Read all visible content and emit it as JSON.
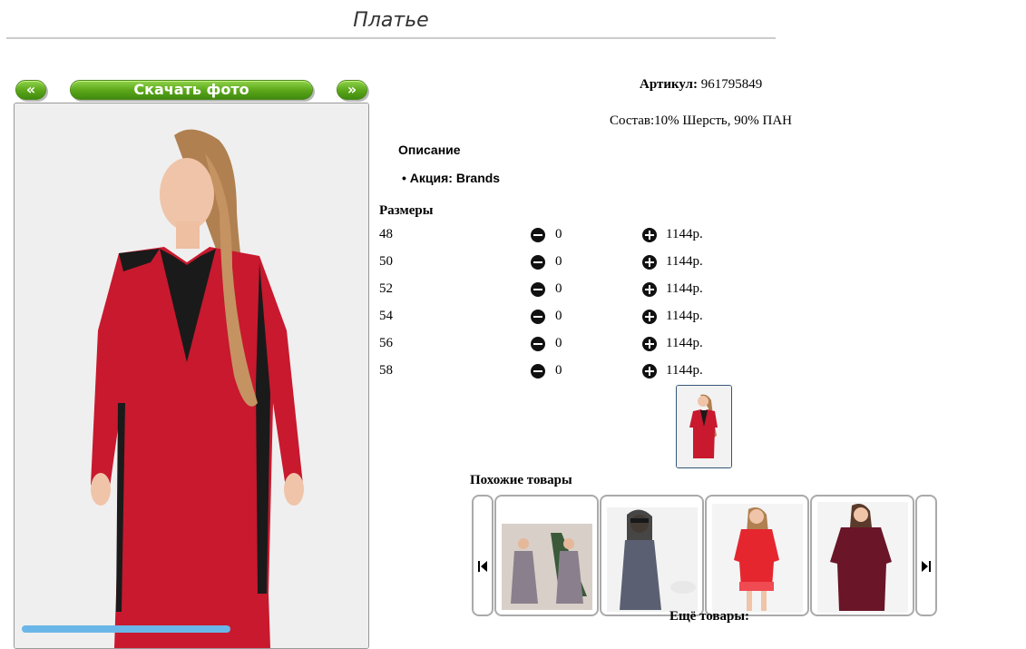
{
  "page": {
    "title": "Платье"
  },
  "gallery": {
    "prev_label": "«",
    "next_label": "»",
    "download_label": "Скачать фото"
  },
  "product": {
    "article_label": "Артикул:",
    "article_value": "961795849",
    "composition": "Состав:10% Шерсть, 90% ПАН",
    "description_title": "Описание",
    "description_item": "Акция: Brands"
  },
  "sizes": {
    "title": "Размеры",
    "rows": [
      {
        "size": "48",
        "qty": "0",
        "price": "1144р."
      },
      {
        "size": "50",
        "qty": "0",
        "price": "1144р."
      },
      {
        "size": "52",
        "qty": "0",
        "price": "1144р."
      },
      {
        "size": "54",
        "qty": "0",
        "price": "1144р."
      },
      {
        "size": "56",
        "qty": "0",
        "price": "1144р."
      },
      {
        "size": "58",
        "qty": "0",
        "price": "1144р."
      }
    ]
  },
  "similar": {
    "title": "Похожие товары",
    "prev_icon": "carousel-prev-icon",
    "next_icon": "carousel-next-icon"
  },
  "more": {
    "title": "Ещё товары:"
  },
  "colors": {
    "button_green": "#5aa518",
    "dress_red": "#c8192e",
    "dress_black": "#1a1a1a"
  }
}
